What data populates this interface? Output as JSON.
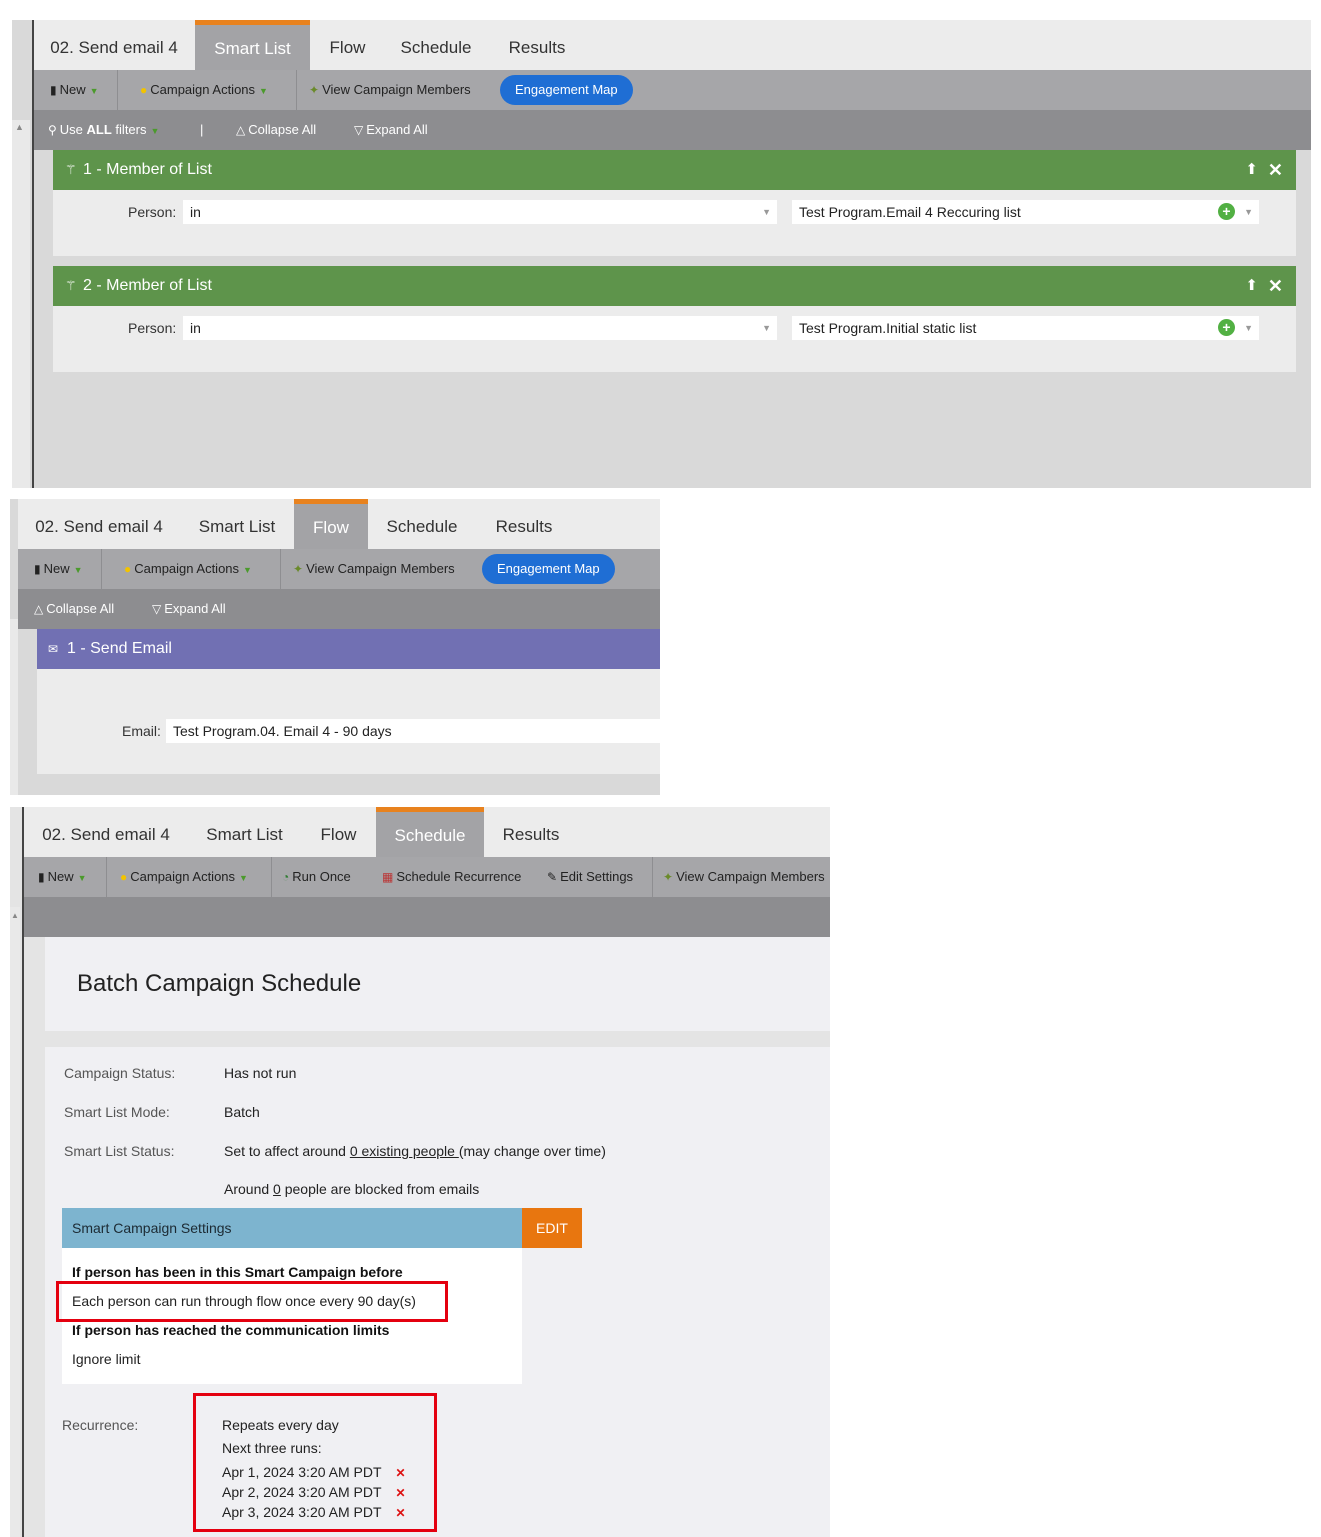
{
  "tabs": {
    "campaign": "02. Send email 4",
    "smart_list": "Smart List",
    "flow": "Flow",
    "schedule": "Schedule",
    "results": "Results"
  },
  "toolbar": {
    "new": "New",
    "campaign_actions": "Campaign Actions",
    "view_members": "View Campaign Members",
    "engagement_map": "Engagement Map",
    "run_once": "Run Once",
    "schedule_recurrence": "Schedule Recurrence",
    "edit_settings": "Edit Settings"
  },
  "smart_list": {
    "use_all_prefix": "Use ",
    "use_all_bold": "ALL",
    "use_all_suffix": " filters",
    "divider": "|",
    "collapse_all": "Collapse All",
    "expand_all": "Expand All",
    "filters": [
      {
        "title": "1 - Member of List",
        "label": "Person:",
        "operator": "in",
        "value": "Test Program.Email 4 Reccuring list"
      },
      {
        "title": "2 - Member of List",
        "label": "Person:",
        "operator": "in",
        "value": "Test Program.Initial static list"
      }
    ]
  },
  "flow": {
    "collapse_all": "Collapse All",
    "expand_all": "Expand All",
    "step_title": "1 - Send Email",
    "email_label": "Email:",
    "email_value": "Test Program.04. Email 4 - 90 days"
  },
  "schedule": {
    "heading": "Batch Campaign Schedule",
    "status_label": "Campaign Status:",
    "status_value": "Has not run",
    "mode_label": "Smart List Mode:",
    "mode_value": "Batch",
    "sl_status_label": "Smart List Status:",
    "sl_status_pre": "Set to affect around ",
    "sl_status_link": "0 existing people ",
    "sl_status_post": "(may change over time)",
    "blocked_pre": "Around ",
    "blocked_link": "0",
    "blocked_post": " people are blocked from emails",
    "settings_title": "Smart Campaign Settings",
    "edit": "EDIT",
    "rule1_heading": "If person has been in this Smart Campaign before",
    "rule1_value": "Each person can run through flow once every 90 day(s)",
    "rule2_heading": "If person has reached the communication limits",
    "rule2_value": "Ignore limit",
    "recurrence_label": "Recurrence:",
    "repeats": "Repeats every day",
    "next_runs_label": "Next three runs:",
    "runs": [
      "Apr 1, 2024 3:20 AM PDT",
      "Apr 2, 2024 3:20 AM PDT",
      "Apr 3, 2024 3:20 AM PDT"
    ]
  },
  "colors": {
    "accent_tab": "#e8821e",
    "filter_green": "#5e944b",
    "flow_purple": "#7170b3",
    "settings_blue": "#7db4cf",
    "edit_orange": "#e8760f",
    "highlight_red": "#e4000f",
    "pill_blue": "#1f6ed4"
  }
}
